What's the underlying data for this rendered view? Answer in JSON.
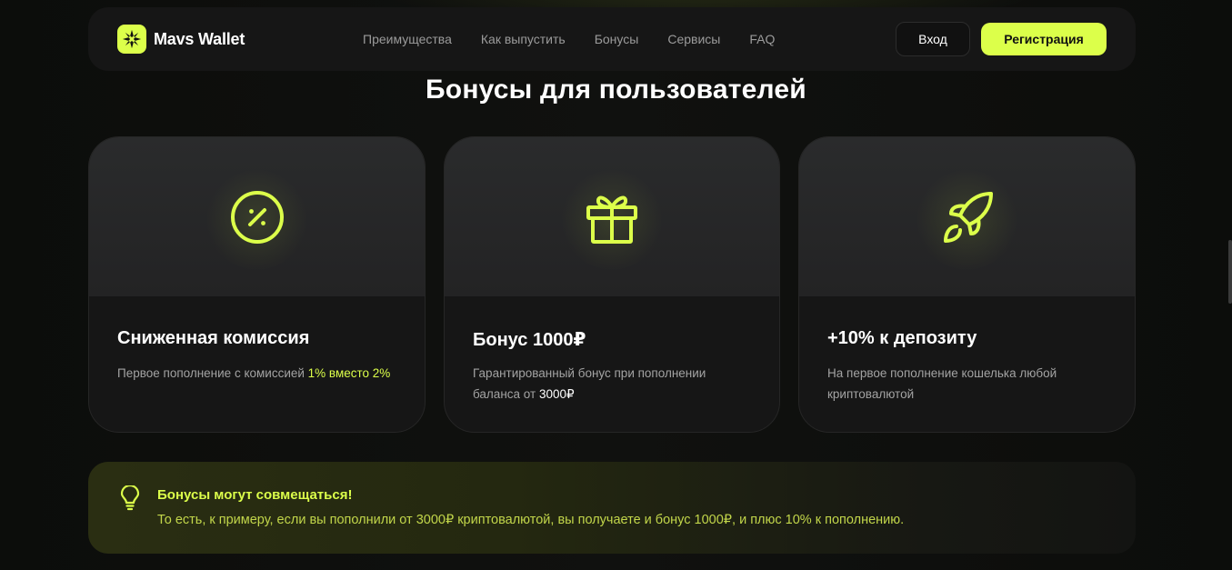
{
  "header": {
    "logo_text": "Mavs Wallet",
    "nav": [
      "Преимущества",
      "Как выпустить",
      "Бонусы",
      "Сервисы",
      "FAQ"
    ],
    "login_label": "Вход",
    "register_label": "Регистрация"
  },
  "section_title": "Бонусы для пользователей",
  "cards": [
    {
      "icon": "percent-icon",
      "title": "Сниженная комиссия",
      "desc_prefix": "Первое пополнение с комиссией ",
      "desc_highlight": "1% вместо 2%",
      "desc_suffix": ""
    },
    {
      "icon": "gift-icon",
      "title": "Бонус 1000₽",
      "desc_prefix": "Гарантированный бонус при пополнении баланса от ",
      "desc_highlight": "3000₽",
      "desc_suffix": ""
    },
    {
      "icon": "rocket-icon",
      "title": "+10% к депозиту",
      "desc_prefix": "На первое пополнение кошелька любой криптовалютой",
      "desc_highlight": "",
      "desc_suffix": ""
    }
  ],
  "notice": {
    "icon": "lightbulb-icon",
    "title": "Бонусы могут совмещаться!",
    "text": "То есть, к примеру, если вы пополнили от 3000₽ криптовалютой, вы получаете и бонус 1000₽, и плюс 10% к пополнению."
  },
  "colors": {
    "accent": "#dcff4a",
    "background": "#0d0e0c",
    "card": "#161616"
  }
}
